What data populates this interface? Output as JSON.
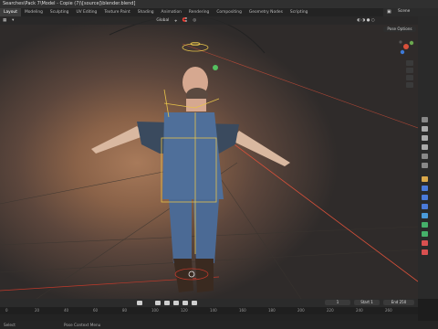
{
  "window_title": "Searches\\Pack 7\\Model - Copie (7)\\[source]\\blender.blend]",
  "workspaces": [
    "Layout",
    "Modeling",
    "Sculpting",
    "UV Editing",
    "Texture Paint",
    "Shading",
    "Animation",
    "Rendering",
    "Compositing",
    "Geometry Nodes",
    "Scripting"
  ],
  "active_workspace": "Layout",
  "top_right": {
    "scene_label": "Scene"
  },
  "viewport_header": {
    "mode": "Global",
    "pose_options": "Pose Options"
  },
  "timeline": {
    "frame_current": "1",
    "start_label": "Start",
    "start_value": "1",
    "end_label": "End",
    "end_value": "250",
    "ticks": [
      "0",
      "20",
      "40",
      "60",
      "80",
      "100",
      "120",
      "140",
      "160",
      "180",
      "200",
      "220",
      "240",
      "260"
    ]
  },
  "status": {
    "left": "Select",
    "middle": "Pose Context Menu"
  },
  "colors": {
    "accent": "#4772b3",
    "bone": "#e6c24a",
    "axis_x": "#d9503a"
  }
}
